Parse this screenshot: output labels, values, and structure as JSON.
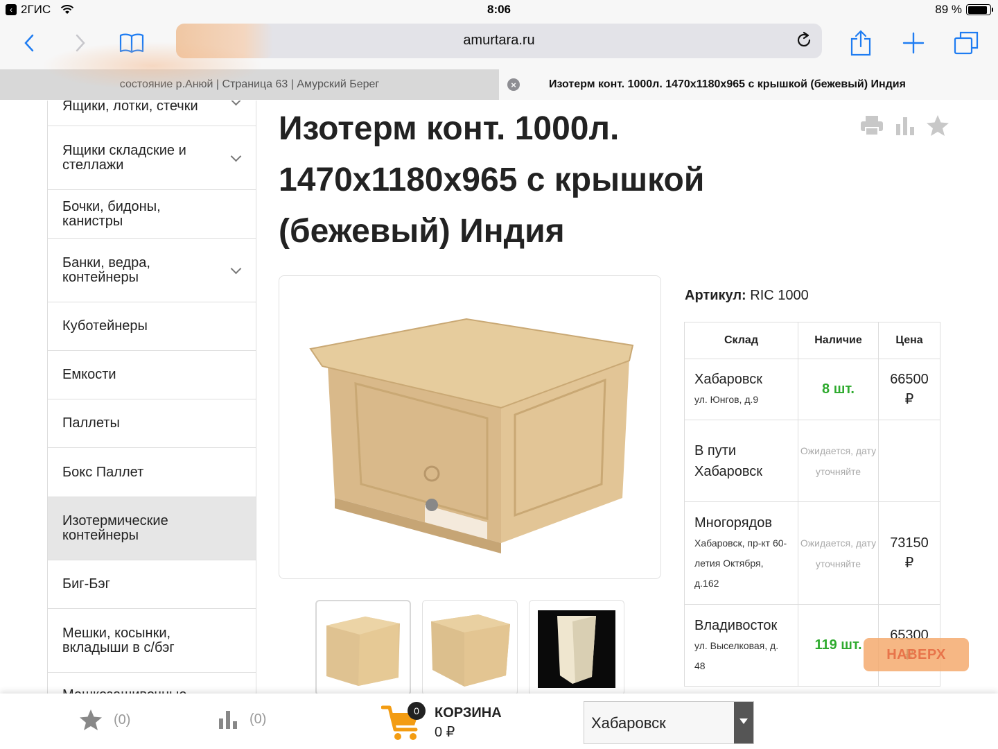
{
  "status_bar": {
    "back_app": "2ГИС",
    "time": "8:06",
    "battery": "89 %"
  },
  "browser": {
    "url": "amurtara.ru",
    "tabs": [
      {
        "title": "состояние р.Анюй | Страница 63 | Амурский Берег"
      },
      {
        "title": "Изотерм конт. 1000л. 1470х1180х965 с крышкой (бежевый) Индия"
      }
    ]
  },
  "sidebar": {
    "items": [
      {
        "label": "Ящики, лотки, стечки",
        "has_submenu": true
      },
      {
        "label": "Ящики складские и стеллажи",
        "has_submenu": true
      },
      {
        "label": "Бочки, бидоны, канистры",
        "has_submenu": false
      },
      {
        "label": "Банки, ведра, контейнеры",
        "has_submenu": true
      },
      {
        "label": "Куботейнеры",
        "has_submenu": false
      },
      {
        "label": "Емкости",
        "has_submenu": false
      },
      {
        "label": "Паллеты",
        "has_submenu": false
      },
      {
        "label": "Бокс Паллет",
        "has_submenu": false
      },
      {
        "label": "Изотермические контейнеры",
        "has_submenu": false,
        "active": true
      },
      {
        "label": "Биг-Бэг",
        "has_submenu": false
      },
      {
        "label": "Мешки, косынки, вкладыши в с/бэг",
        "has_submenu": false
      },
      {
        "label": "Мешкозашивочные",
        "has_submenu": false
      }
    ]
  },
  "product": {
    "title": "Изотерм конт. 1000л. 1470х1180х965 с крышкой (бежевый) Индия",
    "article_label": "Артикул:",
    "article_value": "RIC 1000"
  },
  "stock_table": {
    "headers": [
      "Склад",
      "Наличие",
      "Цена"
    ],
    "rows": [
      {
        "warehouse": "Хабаровск",
        "address": "ул. Юнгов, д.9",
        "availability": "8 шт.",
        "in_stock": true,
        "price": "66500",
        "currency": "₽"
      },
      {
        "warehouse": "В пути Хабаровск",
        "address": "",
        "availability": "Ожидается, дату уточняйте",
        "in_stock": false,
        "price": "",
        "currency": ""
      },
      {
        "warehouse": "Многорядов",
        "address": "Хабаровск, пр-кт 60-летия Октября, д.162",
        "availability": "Ожидается, дату уточняйте",
        "in_stock": false,
        "price": "73150",
        "currency": "₽"
      },
      {
        "warehouse": "Владивосток",
        "address": "ул. Выселковая, д. 48",
        "availability": "119 шт.",
        "in_stock": true,
        "price": "65300",
        "currency": "₽"
      }
    ]
  },
  "to_top_label": "НАВЕРХ",
  "bottom_bar": {
    "favorites_count": "(0)",
    "compare_count": "(0)",
    "cart_badge": "0",
    "cart_label": "КОРЗИНА",
    "cart_sum": "0 ₽",
    "city": "Хабаровск"
  },
  "colors": {
    "accent_orange": "#f39c12",
    "in_stock_green": "#2eaa2e",
    "ios_blue": "#1e7cf2"
  }
}
